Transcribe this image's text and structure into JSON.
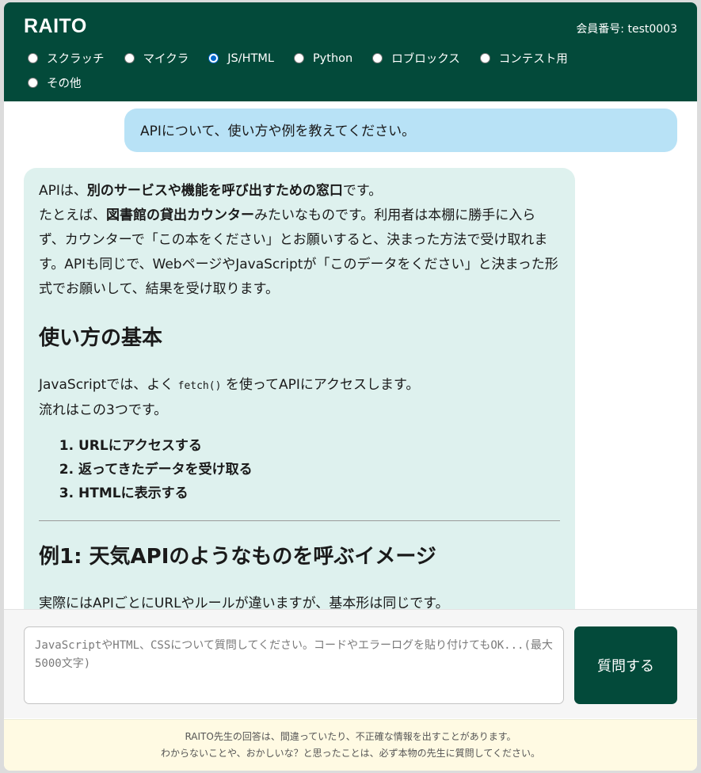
{
  "header": {
    "title": "RAITO",
    "member_label": "会員番号: test0003",
    "categories": [
      {
        "label": "スクラッチ",
        "checked": false
      },
      {
        "label": "マイクラ",
        "checked": false
      },
      {
        "label": "JS/HTML",
        "checked": true
      },
      {
        "label": "Python",
        "checked": false
      },
      {
        "label": "ロブロックス",
        "checked": false
      },
      {
        "label": "コンテスト用",
        "checked": false
      },
      {
        "label": "その他",
        "checked": false
      }
    ]
  },
  "chat": {
    "user_message": "APIについて、使い方や例を教えてください。",
    "bot": {
      "p1_a": "APIは、",
      "p1_b": "別のサービスや機能を呼び出すための窓口",
      "p1_c": "です。",
      "p2_a": "たとえば、",
      "p2_b": "図書館の貸出カウンター",
      "p2_c": "みたいなものです。利用者は本棚に勝手に入らず、カウンターで「この本をください」とお願いすると、決まった方法で受け取れます。APIも同じで、WebページやJavaScriptが「このデータをください」と決まった形式でお願いして、結果を受け取ります。",
      "h_basic": "使い方の基本",
      "p3_a": "JavaScriptでは、よく",
      "p3_code": "fetch()",
      "p3_b": "を使ってAPIにアクセスします。",
      "p3_c": "流れはこの3つです。",
      "steps": [
        "URLにアクセスする",
        "返ってきたデータを受け取る",
        "HTMLに表示する"
      ],
      "h_example": "例1: 天気APIのようなものを呼ぶイメージ",
      "p4": "実際にはAPIごとにURLやルールが違いますが、基本形は同じです。"
    }
  },
  "input": {
    "placeholder": "JavaScriptやHTML、CSSについて質問してください。コードやエラーログを貼り付けてもOK...(最大5000文字)",
    "value": "",
    "submit_label": "質問する"
  },
  "footer": {
    "line1": "RAITO先生の回答は、間違っていたり、不正確な情報を出すことがあります。",
    "line2": "わからないことや、おかしいな？と思ったことは、必ず本物の先生に質問してください。"
  }
}
